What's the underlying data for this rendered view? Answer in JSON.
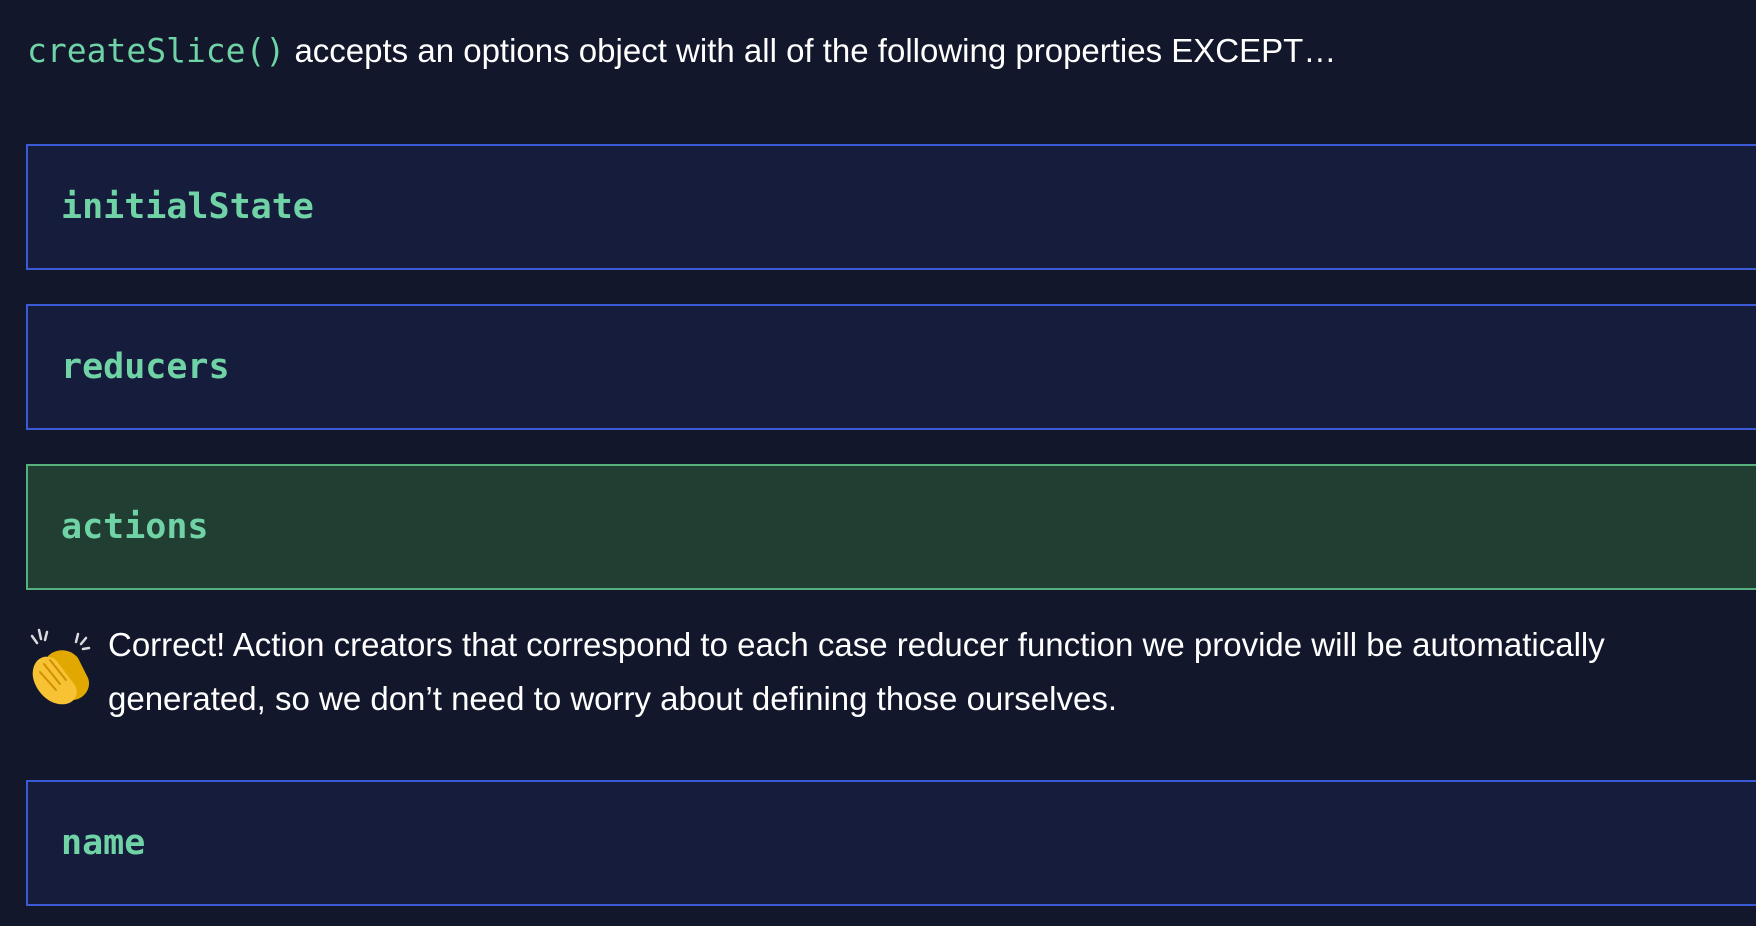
{
  "question": {
    "code": "createSlice()",
    "text": " accepts an options object with all of the following properties EXCEPT…"
  },
  "options": [
    {
      "label": "initialState",
      "state": "default"
    },
    {
      "label": "reducers",
      "state": "default"
    },
    {
      "label": "actions",
      "state": "correct"
    },
    {
      "label": "name",
      "state": "default"
    }
  ],
  "feedback": {
    "icon": "clapping-hands-icon",
    "text": "Correct! Action creators that correspond to each case reducer function we provide will be automatically generated, so we don’t need to worry about defining those ourselves."
  },
  "colors": {
    "background": "#12172b",
    "option_background": "#161c3c",
    "option_border": "#3b5ad6",
    "correct_background": "#213e33",
    "correct_border": "#56b07b",
    "code_text": "#6fd3a6"
  }
}
